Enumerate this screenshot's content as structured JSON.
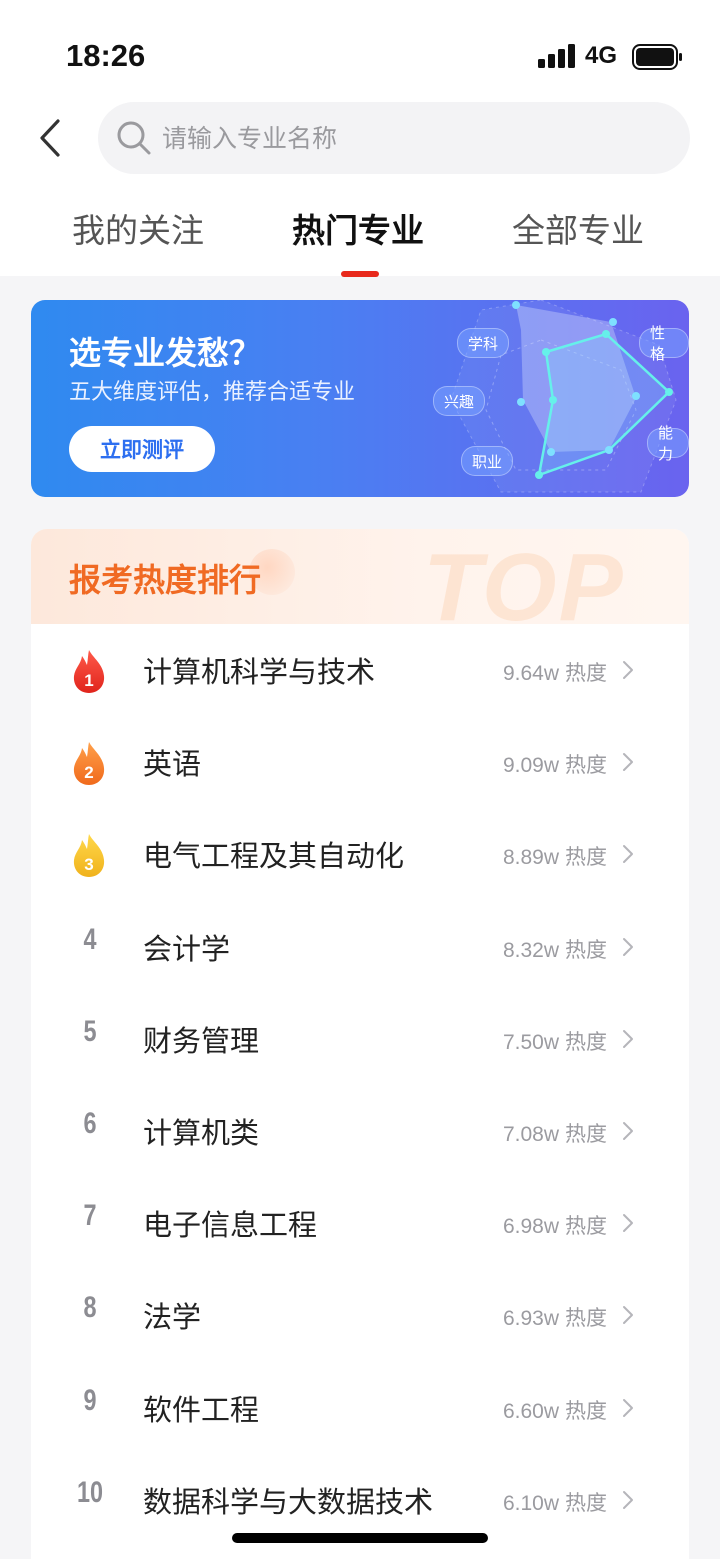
{
  "status": {
    "time": "18:26",
    "network": "4G"
  },
  "search": {
    "placeholder": "请输入专业名称"
  },
  "tabs": [
    {
      "label": "我的关注",
      "active": false
    },
    {
      "label": "热门专业",
      "active": true
    },
    {
      "label": "全部专业",
      "active": false
    }
  ],
  "banner": {
    "title": "选专业发愁？",
    "subtitle": "五大维度评估，推荐合适专业",
    "button": "立即测评",
    "radar_tags": [
      "学科",
      "性格",
      "兴趣",
      "能力",
      "职业"
    ]
  },
  "ranking": {
    "title": "报考热度排行",
    "watermark": "TOP",
    "heat_label": "热度",
    "items": [
      {
        "rank": "1",
        "name": "计算机科学与技术",
        "heat": "9.64w"
      },
      {
        "rank": "2",
        "name": "英语",
        "heat": "9.09w"
      },
      {
        "rank": "3",
        "name": "电气工程及其自动化",
        "heat": "8.89w"
      },
      {
        "rank": "4",
        "name": "会计学",
        "heat": "8.32w"
      },
      {
        "rank": "5",
        "name": "财务管理",
        "heat": "7.50w"
      },
      {
        "rank": "6",
        "name": "计算机类",
        "heat": "7.08w"
      },
      {
        "rank": "7",
        "name": "电子信息工程",
        "heat": "6.98w"
      },
      {
        "rank": "8",
        "name": "法学",
        "heat": "6.93w"
      },
      {
        "rank": "9",
        "name": "软件工程",
        "heat": "6.60w"
      },
      {
        "rank": "10",
        "name": "数据科学与大数据技术",
        "heat": "6.10w"
      }
    ]
  },
  "colors": {
    "accent": "#e8291c",
    "rank_title": "#f06a23",
    "banner_start": "#2f8af0",
    "banner_end": "#6a63ef"
  }
}
